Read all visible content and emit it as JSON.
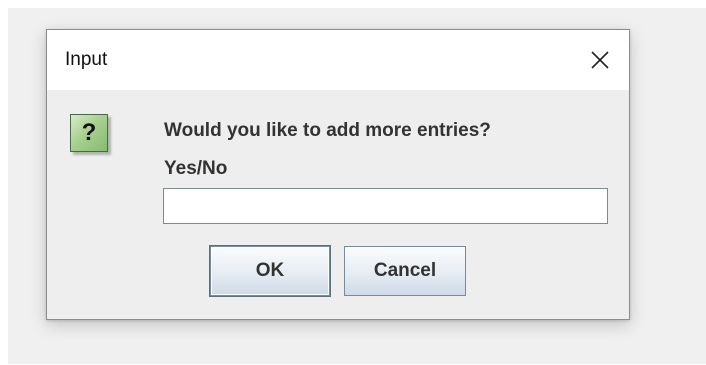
{
  "dialog": {
    "title": "Input",
    "close_icon": "close-icon",
    "icon": {
      "name": "question-icon",
      "glyph": "?",
      "color": "#a8d091"
    },
    "message": "Would you like to add more entries?",
    "sublabel": "Yes/No",
    "input": {
      "value": "",
      "placeholder": ""
    },
    "buttons": {
      "ok_label": "OK",
      "cancel_label": "Cancel"
    }
  },
  "colors": {
    "dialog_background": "#eeeeee",
    "titlebar_background": "#ffffff",
    "text": "#333333",
    "button_border": "#7a8a99"
  }
}
